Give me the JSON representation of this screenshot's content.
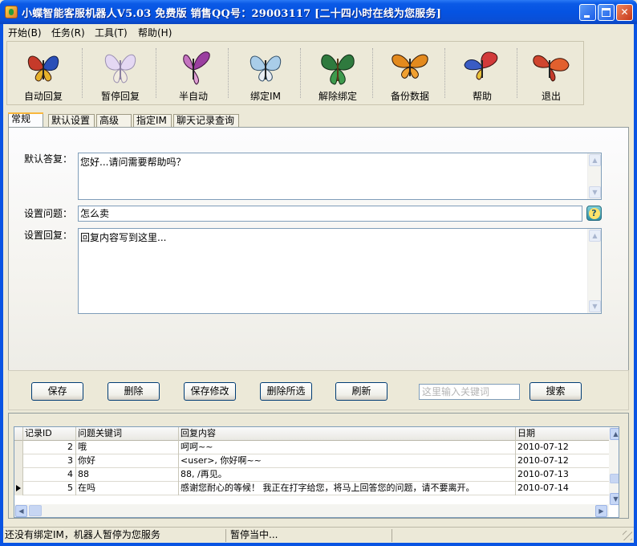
{
  "window": {
    "title": "小蝶智能客服机器人V5.03 免费版   销售QQ号：29003117 [二十四小时在线为您服务]"
  },
  "menu": [
    "开始(B)",
    "任务(R)",
    "工具(T)",
    "帮助(H)"
  ],
  "toolbar": [
    {
      "label": "自动回复",
      "icon": "butterfly-red-blue-icon",
      "color": "#c63a2a"
    },
    {
      "label": "暂停回复",
      "icon": "butterfly-pale-icon",
      "color": "#c9b8e8"
    },
    {
      "label": "半自动",
      "icon": "butterfly-purple-icon",
      "color": "#9b3fa0"
    },
    {
      "label": "绑定IM",
      "icon": "butterfly-blue-icon",
      "color": "#7eb3d9"
    },
    {
      "label": "解除绑定",
      "icon": "butterfly-green-icon",
      "color": "#2f7a3e"
    },
    {
      "label": "备份数据",
      "icon": "butterfly-orange-icon",
      "color": "#e38a1e"
    },
    {
      "label": "帮助",
      "icon": "butterfly-red-icon",
      "color": "#d23a3a"
    },
    {
      "label": "退出",
      "icon": "butterfly-red-orange-icon",
      "color": "#d0452e"
    }
  ],
  "tabs": [
    "常规",
    "默认设置",
    "高级",
    "指定IM",
    "聊天记录查询"
  ],
  "form": {
    "default_reply_label": "默认答复：",
    "default_reply_value": "您好...请问需要帮助吗？",
    "question_label": "设置问题：",
    "question_value": "怎么卖",
    "reply_label": "设置回复：",
    "reply_value": "回复内容写到这里..."
  },
  "actions": {
    "save": "保存",
    "delete": "删除",
    "save_edit": "保存修改",
    "delete_selected": "删除所选",
    "refresh": "刷新",
    "search_placeholder": "这里输入关键词",
    "search": "搜索"
  },
  "grid": {
    "columns": [
      "记录ID",
      "问题关键词",
      "回复内容",
      "日期"
    ],
    "rows": [
      {
        "id": "2",
        "keyword": "哦",
        "reply": "呵呵~~",
        "date": "2010-07-12"
      },
      {
        "id": "3",
        "keyword": "你好",
        "reply": "<user>, 你好啊~~",
        "date": "2010-07-12"
      },
      {
        "id": "4",
        "keyword": "88",
        "reply": "88, /再见。",
        "date": "2010-07-13"
      },
      {
        "id": "5",
        "keyword": "在吗",
        "reply": "感谢您耐心的等候！ 我正在打字给您，将马上回答您的问题，请不要离开。",
        "date": "2010-07-14"
      }
    ]
  },
  "status": {
    "left": "还没有绑定IM，机器人暂停为您服务",
    "right": "暂停当中..."
  }
}
